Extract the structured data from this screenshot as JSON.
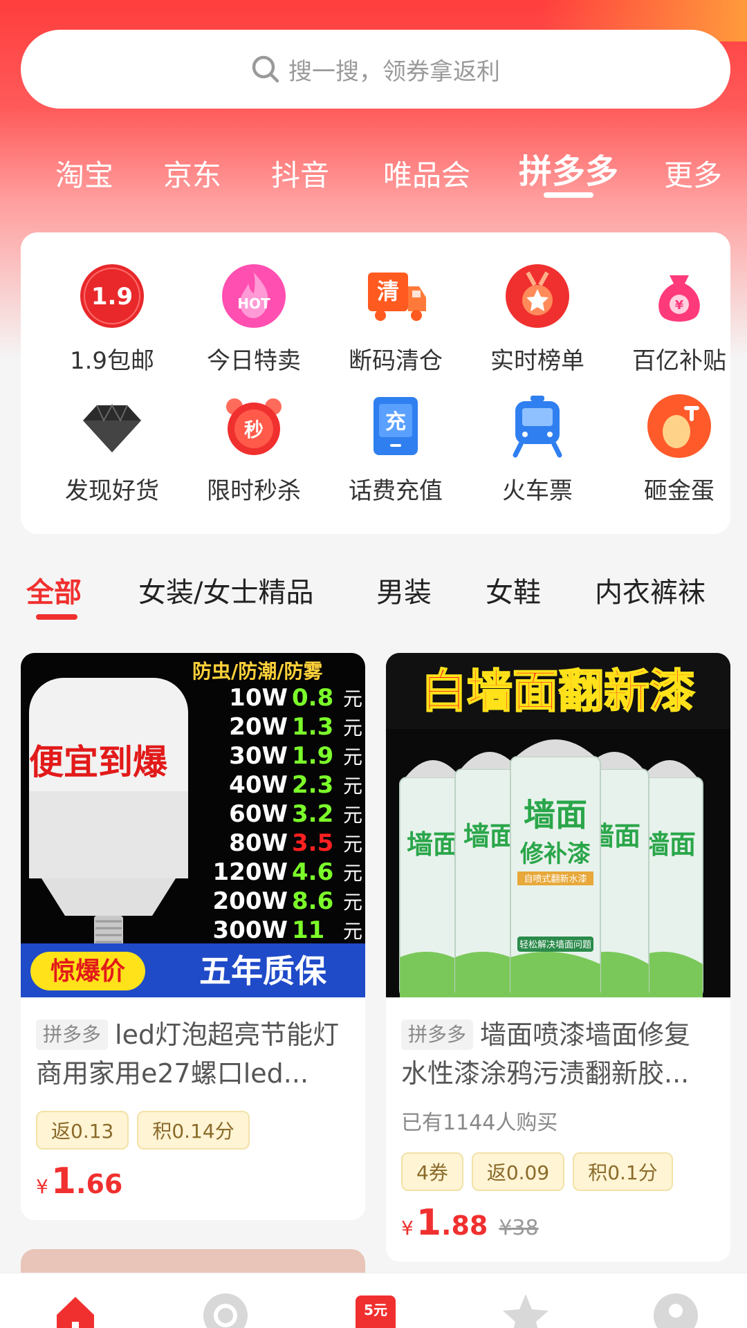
{
  "search": {
    "placeholder": "搜一搜，领券拿返利"
  },
  "platform_tabs": [
    {
      "label": "淘宝"
    },
    {
      "label": "京东"
    },
    {
      "label": "抖音"
    },
    {
      "label": "唯品会"
    },
    {
      "label": "拼多多",
      "active": true
    },
    {
      "label": "更多"
    }
  ],
  "quick_entries": [
    {
      "label": "1.9包邮",
      "icon": "badge-1.9-icon",
      "badge": "1.9"
    },
    {
      "label": "今日特卖",
      "icon": "hot-flame-icon",
      "badge": "HOT"
    },
    {
      "label": "断码清仓",
      "icon": "clearance-truck-icon",
      "badge": "清"
    },
    {
      "label": "实时榜单",
      "icon": "medal-icon"
    },
    {
      "label": "百亿补贴",
      "icon": "money-bag-icon"
    },
    {
      "label": "发现好货",
      "icon": "diamond-icon"
    },
    {
      "label": "限时秒杀",
      "icon": "alarm-clock-icon",
      "badge": "秒"
    },
    {
      "label": "话费充值",
      "icon": "phone-recharge-icon",
      "badge": "充"
    },
    {
      "label": "火车票",
      "icon": "train-icon"
    },
    {
      "label": "砸金蛋",
      "icon": "golden-egg-icon"
    }
  ],
  "category_tabs": [
    {
      "label": "全部",
      "active": true
    },
    {
      "label": "女装/女士精品"
    },
    {
      "label": "男装"
    },
    {
      "label": "女鞋"
    },
    {
      "label": "内衣裤袜"
    }
  ],
  "products": [
    {
      "source": "拼多多",
      "title": "led灯泡超亮节能灯商用家用e27螺口led...",
      "image": {
        "headline": "防虫/防潮/防雾",
        "slogan": "便宜到爆",
        "banner_left": "惊爆价",
        "banner_right": "五年质保",
        "rows": [
          {
            "w": "10W",
            "p": "0.8"
          },
          {
            "w": "20W",
            "p": "1.3"
          },
          {
            "w": "30W",
            "p": "1.9"
          },
          {
            "w": "40W",
            "p": "2.3"
          },
          {
            "w": "60W",
            "p": "3.2"
          },
          {
            "w": "80W",
            "p": "3.5"
          },
          {
            "w": "120W",
            "p": "4.6"
          },
          {
            "w": "200W",
            "p": "8.6"
          },
          {
            "w": "300W",
            "p": "11"
          }
        ],
        "unit": "元"
      },
      "chips": [
        "返0.13",
        "积0.14分"
      ],
      "price_symbol": "¥",
      "price_int": "1",
      "price_dec": ".66"
    },
    {
      "source": "拼多多",
      "title": "墙面喷漆墙面修复水性漆涂鸦污渍翻新胶...",
      "image": {
        "headline": "白墙面翻新漆",
        "can_line1": "墙面",
        "can_line2": "修补漆",
        "can_sub": "自喷式翻新水漆",
        "can_bottom": "轻松解决墙面问题"
      },
      "sold": "已有1144人购买",
      "chips": [
        "4券",
        "返0.09",
        "积0.1分"
      ],
      "price_symbol": "¥",
      "price_int": "1",
      "price_dec": ".88",
      "original_price": "¥38"
    }
  ],
  "tab_bar": {
    "items": [
      {
        "icon": "home-icon"
      },
      {
        "icon": "discover-icon"
      },
      {
        "icon": "five-yuan-icon",
        "badge": "5元"
      },
      {
        "icon": "star-icon"
      },
      {
        "icon": "profile-icon"
      }
    ]
  },
  "colors": {
    "accent": "#f0302f",
    "hero_top": "#ff3d3d",
    "chip_bg": "#fff4d4"
  }
}
